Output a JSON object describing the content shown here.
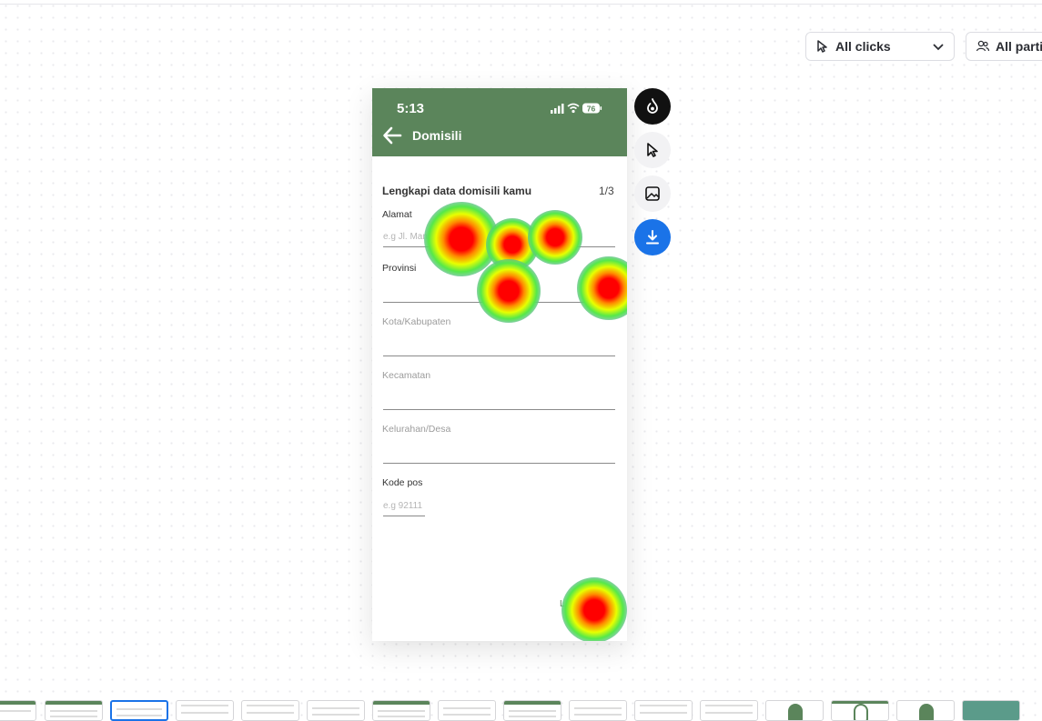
{
  "filters": {
    "clicks_label": "All clicks",
    "participants_label": "All partic"
  },
  "phone": {
    "status_time": "5:13",
    "battery": "76",
    "title": "Domisili",
    "form_heading": "Lengkapi data domisili kamu",
    "step": "1/3",
    "fields": [
      {
        "label": "Alamat",
        "placeholder": "e.g Jl. Man"
      },
      {
        "label": "Provinsi",
        "placeholder": ""
      },
      {
        "label": "Kota/Kabupaten",
        "placeholder": ""
      },
      {
        "label": "Kecamatan",
        "placeholder": ""
      },
      {
        "label": "Kelurahan/Desa",
        "placeholder": ""
      },
      {
        "label": "Kode pos",
        "placeholder": "e.g 92111"
      }
    ],
    "next_label": "LANJ"
  },
  "toolbar": {
    "icons": [
      "heatmap-icon",
      "click-cursor-icon",
      "image-icon",
      "download-icon"
    ]
  },
  "colors": {
    "brand_green": "#5b855b",
    "accent_blue": "#1a73e8",
    "heat_core": "#ff0000"
  }
}
